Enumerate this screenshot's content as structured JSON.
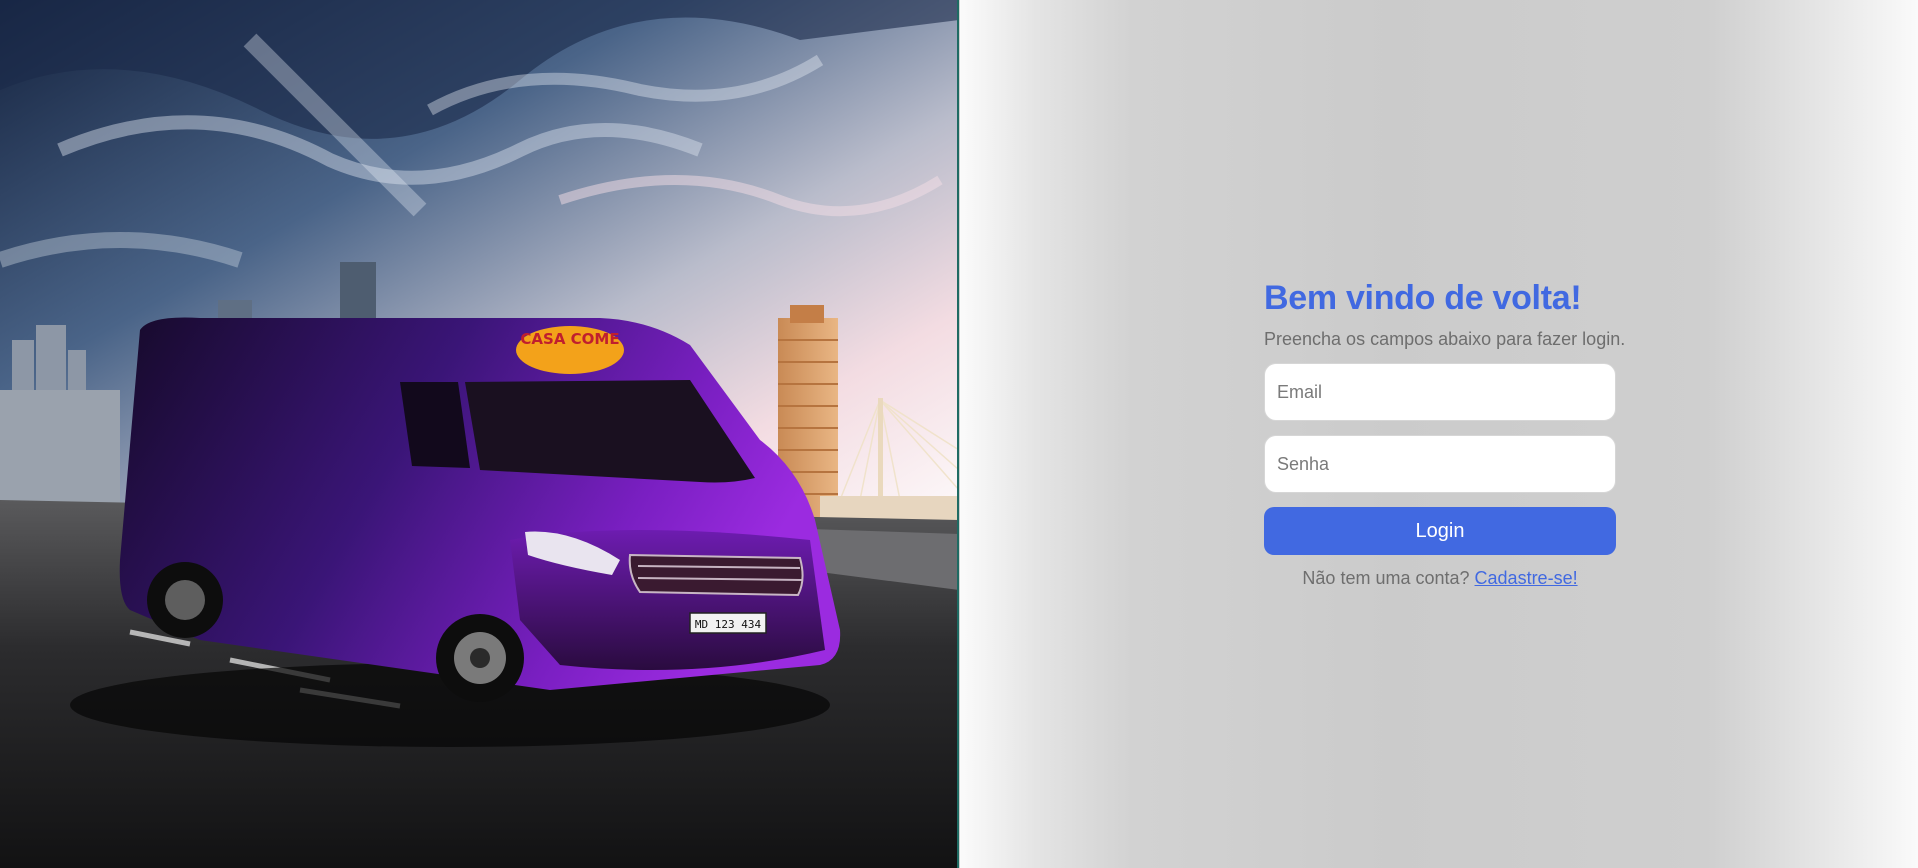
{
  "hero": {
    "image_description": "Purple delivery van on a rooftop road with city skyline and dramatic sky",
    "van_brand": "CASA COME",
    "license_plate": "MD 123 434"
  },
  "login": {
    "title": "Bem vindo de volta!",
    "subtitle": "Preencha os campos abaixo para fazer login.",
    "email_placeholder": "Email",
    "password_placeholder": "Senha",
    "submit_label": "Login",
    "no_account_text": "Não tem uma conta?",
    "signup_link_label": "Cadastre-se!"
  },
  "colors": {
    "accent": "#4169e1",
    "muted_text": "#6e6e6e",
    "van_purple": "#7a1fc2"
  }
}
